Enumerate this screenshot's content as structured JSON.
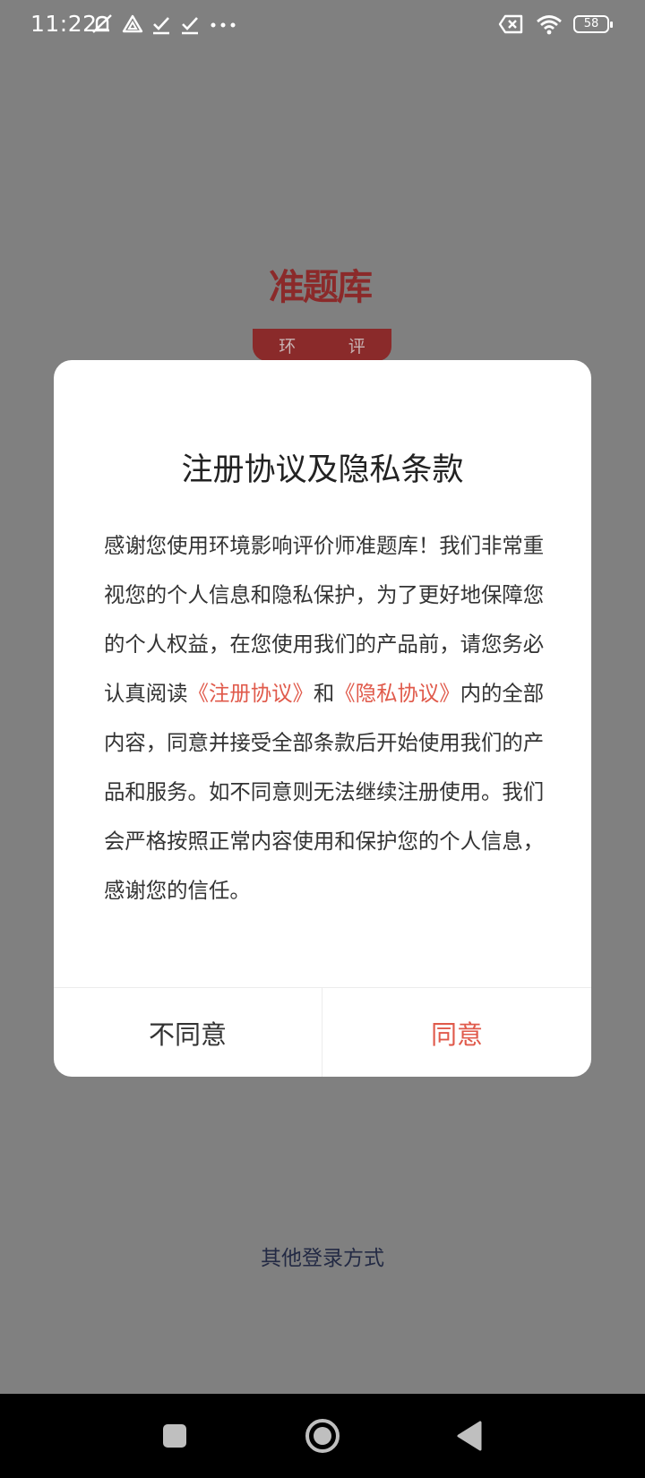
{
  "status_bar": {
    "time": "11:22",
    "battery": "58",
    "icons_left": [
      "muted-bell-icon",
      "drive-icon",
      "check-icon",
      "check-icon",
      "more-dots-icon"
    ],
    "icons_right": [
      "no-sim-icon",
      "wifi-icon",
      "battery-icon"
    ]
  },
  "background": {
    "logo_text": "准题库",
    "subject_chars": [
      "环",
      "评"
    ],
    "other_login": "其他登录方式"
  },
  "dialog": {
    "title": "注册协议及隐私条款",
    "body_before": "感谢您使用环境影响评价师准题库！我们非常重视您的个人信息和隐私保护，为了更好地保障您的个人权益，在您使用我们的产品前，请您务必认真阅读",
    "link_register": "《注册协议》",
    "conjunction": "和",
    "link_privacy": "《隐私协议》",
    "body_after": "内的全部内容，同意并接受全部条款后开始使用我们的产品和服务。如不同意则无法继续注册使用。我们会严格按照正常内容使用和保护您的个人信息，感谢您的信任。",
    "disagree_label": "不同意",
    "agree_label": "同意"
  },
  "colors": {
    "accent": "#e05a4b",
    "scrim": "#808080",
    "brand": "#8b2a2a"
  }
}
